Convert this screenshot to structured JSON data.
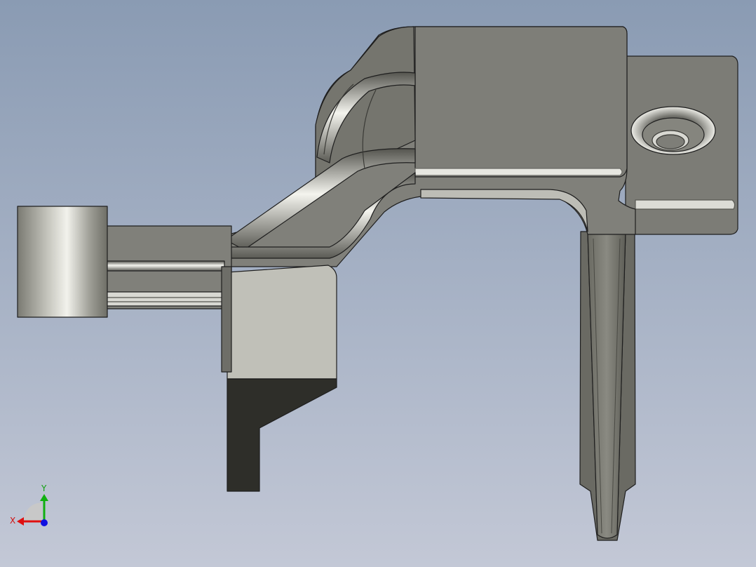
{
  "viewport": {
    "background_top": "#8a9bb3",
    "background_bottom": "#c3c8d6"
  },
  "triad": {
    "x_label": "X",
    "y_label": "Y",
    "x_color": "#e01010",
    "y_color": "#10b010",
    "z_color": "#1010e0"
  },
  "model": {
    "face_color": "#80807a",
    "light_face_color": "#c0c0b8",
    "dark_face_color": "#2e2e29",
    "edge_color": "#1e1e1e"
  }
}
